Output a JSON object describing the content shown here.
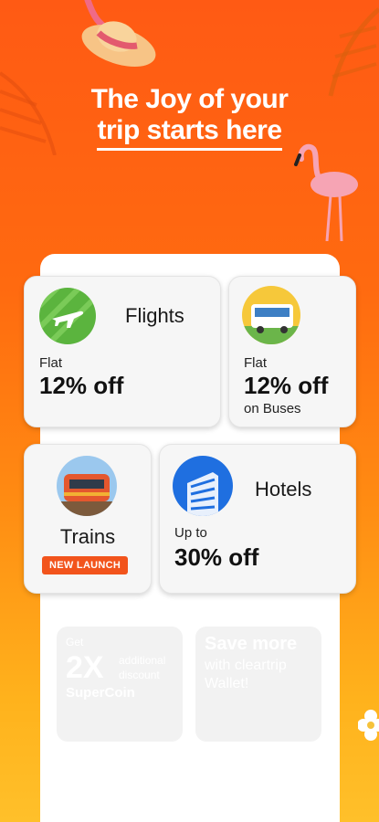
{
  "headline": {
    "line1": "The Joy of your",
    "line2": "trip starts here"
  },
  "cards": {
    "flights": {
      "title": "Flights",
      "label": "Flat",
      "offer": "12% off",
      "icon": "airplane-icon"
    },
    "buses": {
      "label": "Flat",
      "offer": "12% off",
      "sub": "on Buses",
      "icon": "bus-icon"
    },
    "trains": {
      "title": "Trains",
      "badge": "NEW LAUNCH",
      "icon": "train-icon"
    },
    "hotels": {
      "title": "Hotels",
      "label": "Up to",
      "offer": "30% off",
      "icon": "hotel-building-icon"
    }
  },
  "promos": {
    "supercoin": {
      "pre": "Get",
      "big": "2X",
      "sub1": "additional",
      "sub2": "discount",
      "brand": "SuperCoin"
    },
    "wallet": {
      "line1": "Save more",
      "line2": "with cleartrip",
      "line3": "Wallet!"
    }
  },
  "colors": {
    "accent": "#F2541C",
    "flights_icon": "#5BB43E",
    "hotels_icon": "#1F6FE0"
  }
}
